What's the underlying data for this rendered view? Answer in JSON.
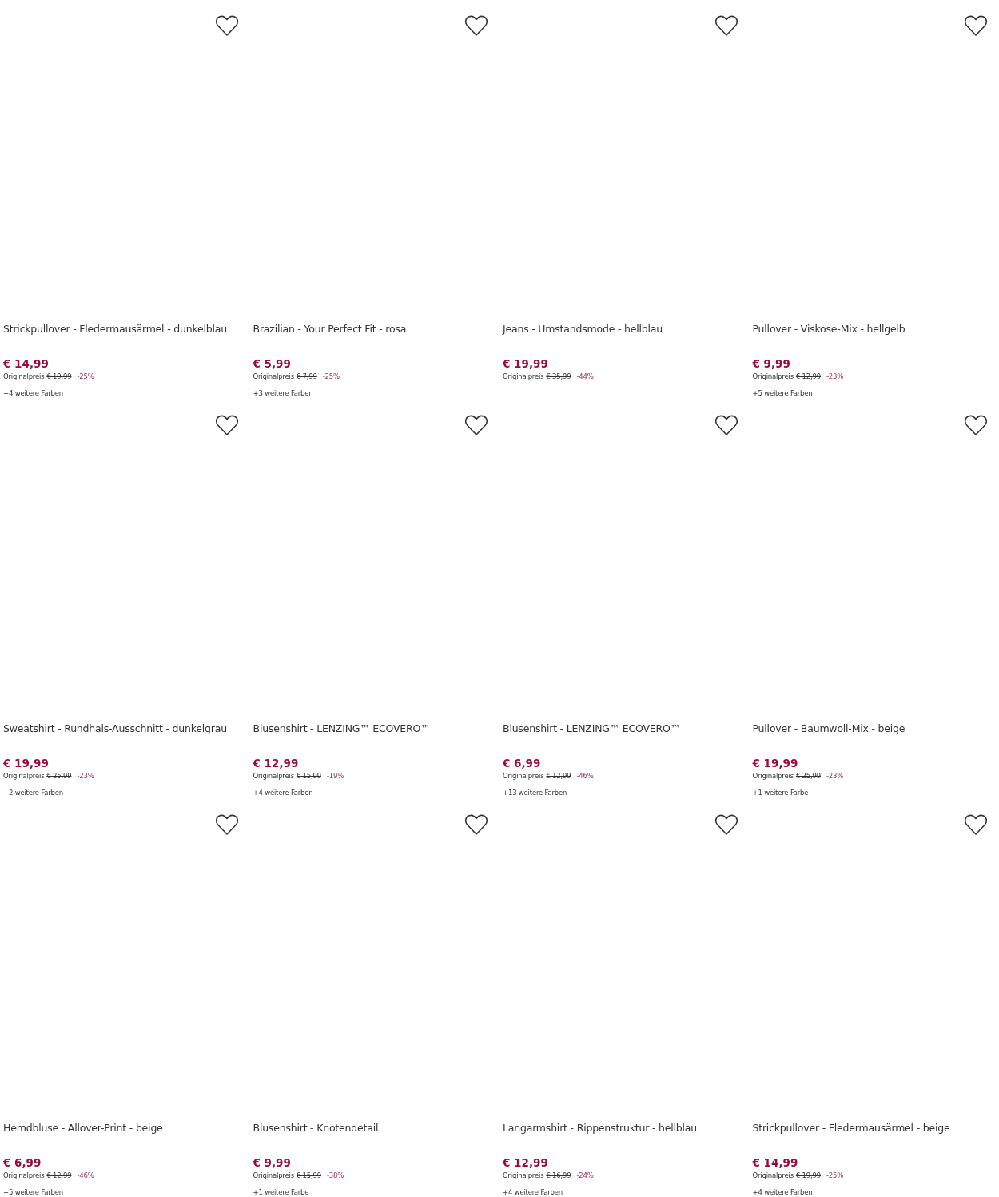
{
  "products": [
    {
      "title": "Strickpullover - Fledermausärmel - dunkelblau",
      "price": "€ 14,99",
      "original_label": "Originalpreis",
      "original_price": "€ 19,99",
      "discount": "-25%",
      "colors": "+4 weitere Farben"
    },
    {
      "title": "Brazilian - Your Perfect Fit - rosa",
      "price": "€ 5,99",
      "original_label": "Originalpreis",
      "original_price": "€ 7,99",
      "discount": "-25%",
      "colors": "+3 weitere Farben"
    },
    {
      "title": "Jeans - Umstandsmode - hellblau",
      "price": "€ 19,99",
      "original_label": "Originalpreis",
      "original_price": "€ 35,99",
      "discount": "-44%"
    },
    {
      "title": "Pullover - Viskose-Mix - hellgelb",
      "price": "€ 9,99",
      "original_label": "Originalpreis",
      "original_price": "€ 12,99",
      "discount": "-23%",
      "colors": "+5 weitere Farben"
    },
    {
      "title": "Sweatshirt - Rundhals-Ausschnitt - dunkelgrau",
      "price": "€ 19,99",
      "original_label": "Originalpreis",
      "original_price": "€ 25,99",
      "discount": "-23%",
      "colors": "+2 weitere Farben"
    },
    {
      "title": "Blusenshirt - LENZING™ ECOVERO™",
      "price": "€ 12,99",
      "original_label": "Originalpreis",
      "original_price": "€ 15,99",
      "discount": "-19%",
      "colors": "+4 weitere Farben"
    },
    {
      "title": "Blusenshirt - LENZING™ ECOVERO™",
      "price": "€ 6,99",
      "original_label": "Originalpreis",
      "original_price": "€ 12,99",
      "discount": "-46%",
      "colors": "+13 weitere Farben"
    },
    {
      "title": "Pullover - Baumwoll-Mix - beige",
      "price": "€ 19,99",
      "original_label": "Originalpreis",
      "original_price": "€ 25,99",
      "discount": "-23%",
      "colors": "+1 weitere Farbe"
    },
    {
      "title": "Hemdbluse - Allover-Print - beige",
      "price": "€ 6,99",
      "original_label": "Originalpreis",
      "original_price": "€ 12,99",
      "discount": "-46%",
      "colors": "+5 weitere Farben"
    },
    {
      "title": "Blusenshirt - Knotendetail",
      "price": "€ 9,99",
      "original_label": "Originalpreis",
      "original_price": "€ 15,99",
      "discount": "-38%",
      "colors": "+1 weitere Farbe"
    },
    {
      "title": "Langarmshirt - Rippenstruktur - hellblau",
      "price": "€ 12,99",
      "original_label": "Originalpreis",
      "original_price": "€ 16,99",
      "discount": "-24%",
      "colors": "+4 weitere Farben"
    },
    {
      "title": "Strickpullover - Fledermausärmel - beige",
      "price": "€ 14,99",
      "original_label": "Originalpreis",
      "original_price": "€ 19,99",
      "discount": "-25%",
      "colors": "+4 weitere Farben"
    }
  ]
}
